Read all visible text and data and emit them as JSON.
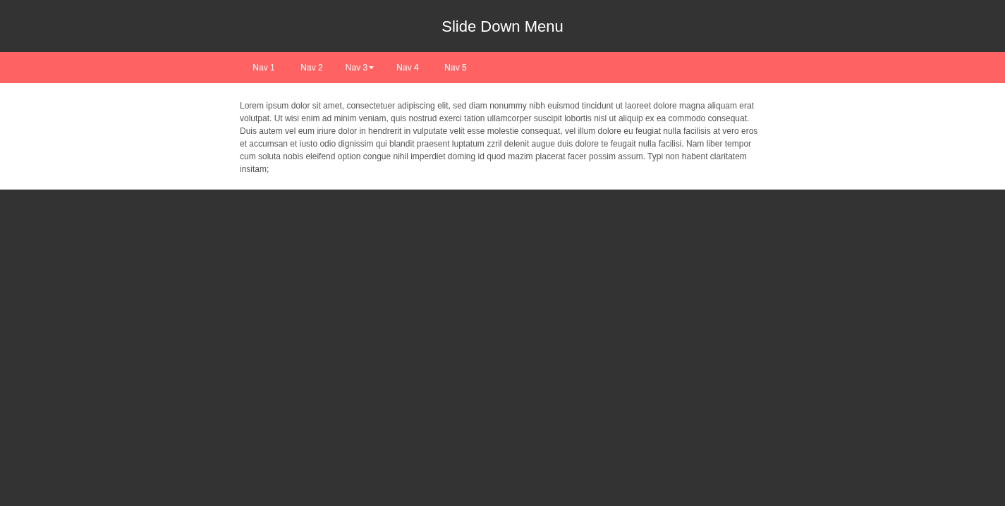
{
  "header": {
    "title": "Slide Down Menu"
  },
  "nav": [
    {
      "label": "Nav 1",
      "has_dropdown": false
    },
    {
      "label": "Nav 2",
      "has_dropdown": false
    },
    {
      "label": "Nav 3",
      "has_dropdown": true
    },
    {
      "label": "Nav 4",
      "has_dropdown": false
    },
    {
      "label": "Nav 5",
      "has_dropdown": false
    }
  ],
  "content": {
    "paragraph": "Lorem ipsum dolor sit amet, consectetuer adipiscing elit, sed diam nonummy nibh euismod tincidunt ut laoreet dolore magna aliquam erat volutpat. Ut wisi enim ad minim veniam, quis nostrud exerci tation ullamcorper suscipit lobortis nisl ut aliquip ex ea commodo consequat. Duis autem vel eum iriure dolor in hendrerit in vulputate velit esse molestie consequat, vel illum dolore eu feugiat nulla facilisis at vero eros et accumsan et iusto odio dignissim qui blandit praesent luptatum zzril delenit augue duis dolore te feugait nulla facilisi. Nam liber tempor cum soluta nobis eleifend option congue nihil imperdiet doming id quod mazim placerat facer possim assum. Typi non habent claritatem insitam;"
  }
}
